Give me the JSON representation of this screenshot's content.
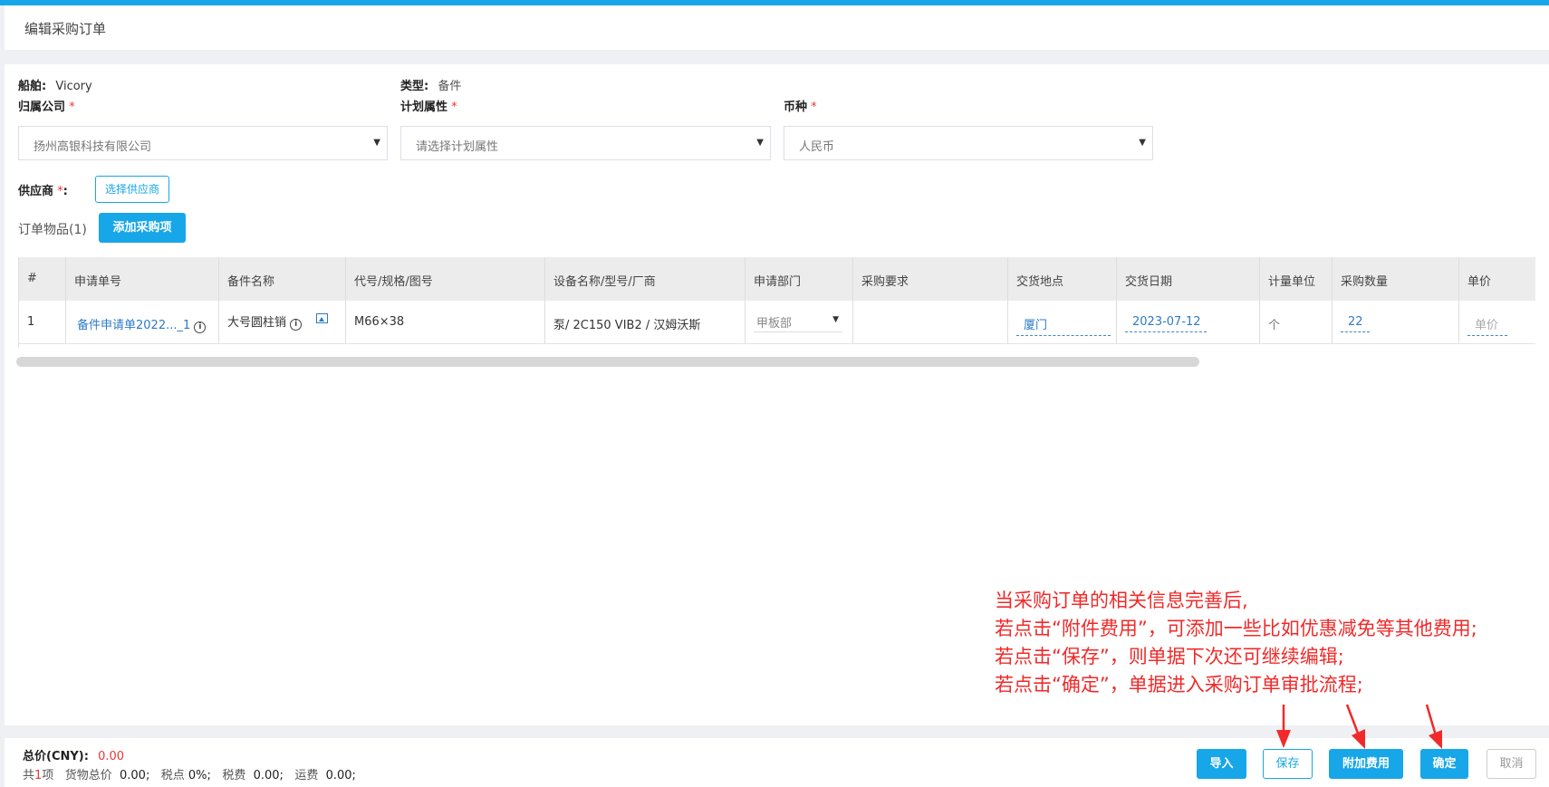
{
  "header": {
    "title": "编辑采购订单"
  },
  "form": {
    "ship_label": "船舶:",
    "ship_value": "Vicory",
    "type_label": "类型:",
    "type_value": "备件",
    "company_label": "归属公司",
    "company_value": "扬州高银科技有限公司",
    "plan_label": "计划属性",
    "plan_placeholder": "请选择计划属性",
    "currency_label": "币种",
    "currency_value": "人民币",
    "required_mark": "*",
    "supplier_label": "供应商",
    "supplier_colon": ":",
    "select_supplier_button": "选择供应商",
    "items_label": "订单物品(1)",
    "add_item_button": "添加采购项"
  },
  "table": {
    "columns": [
      "#",
      "申请单号",
      "备件名称",
      "代号/规格/图号",
      "设备名称/型号/厂商",
      "申请部门",
      "采购要求",
      "交货地点",
      "交货日期",
      "计量单位",
      "采购数量",
      "单价"
    ],
    "rows": [
      {
        "index": "1",
        "request_no": "备件申请单2022..._1",
        "part_name": "大号圆柱销",
        "code": "M66×38",
        "equipment": "泵/ 2C150 VIB2 / 汉姆沃斯",
        "department": "甲板部",
        "requirement": "",
        "location": "厦门",
        "date": "2023-07-12",
        "unit": "个",
        "quantity": "22",
        "price_placeholder": "单价"
      }
    ]
  },
  "annotation": {
    "lines": [
      "当采购订单的相关信息完善后,",
      "若点击“附件费用”，可添加一些比如优惠减免等其他费用;",
      "若点击“保存”，则单据下次还可继续编辑;",
      "若点击“确定”，单据进入采购订单审批流程;"
    ],
    "color": "#f02a2a"
  },
  "footer": {
    "total_label": "总价(CNY):",
    "total_value": "0.00",
    "count_prefix": "共",
    "count_value": "1",
    "count_suffix": "项",
    "goods_label": "货物总价",
    "goods_value": "0.00;",
    "tax_rate_label": "税点",
    "tax_rate_value": "0%;",
    "tax_label": "税费",
    "tax_value": "0.00;",
    "freight_label": "运费",
    "freight_value": "0.00;",
    "buttons": {
      "import": "导入",
      "save": "保存",
      "extra_fee": "附加费用",
      "confirm": "确定",
      "cancel": "取消"
    }
  },
  "colors": {
    "accent": "#17a6e8",
    "link": "#2d7bc6",
    "required": "#e53935",
    "total": "#e53935"
  }
}
